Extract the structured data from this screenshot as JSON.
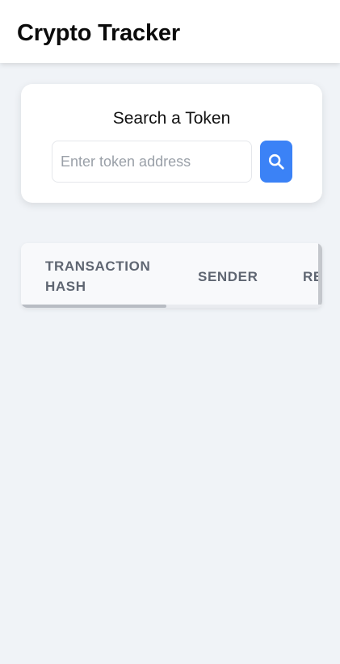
{
  "header": {
    "title": "Crypto Tracker"
  },
  "search": {
    "title": "Search a Token",
    "placeholder": "Enter token address",
    "value": "",
    "button_icon": "search-icon",
    "button_color": "#3b82f6"
  },
  "table": {
    "columns": [
      "TRANSACTION HASH",
      "SENDER",
      "RECIPIENT"
    ],
    "rows": []
  },
  "colors": {
    "background": "#f0f3f7",
    "card": "#ffffff",
    "accent": "#3b82f6",
    "header_text": "#5f6672"
  }
}
